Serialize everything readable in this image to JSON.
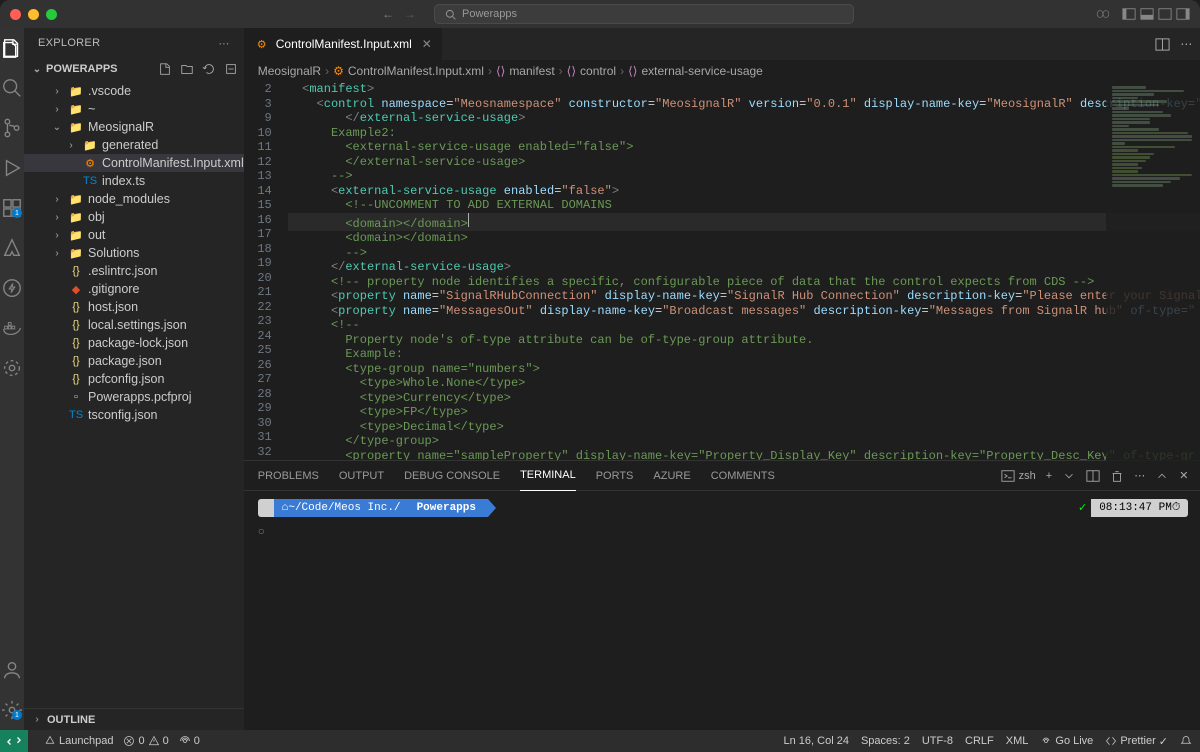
{
  "titlebar": {
    "search": "Powerapps"
  },
  "explorer": {
    "title": "EXPLORER",
    "project": "POWERAPPS",
    "outline": "OUTLINE"
  },
  "tree": [
    {
      "indent": 1,
      "chev": "›",
      "icon": "folder",
      "color": "folder-ico",
      "label": ".vscode"
    },
    {
      "indent": 1,
      "chev": "›",
      "icon": "folder",
      "color": "folder-ico",
      "label": "~"
    },
    {
      "indent": 1,
      "chev": "⌄",
      "icon": "folder",
      "color": "folder-ico git",
      "label": "MeosignalR"
    },
    {
      "indent": 2,
      "chev": "›",
      "icon": "folder",
      "color": "folder-ico git",
      "label": "generated"
    },
    {
      "indent": 2,
      "chev": "",
      "icon": "xml",
      "color": "xml-ico",
      "label": "ControlManifest.Input.xml",
      "selected": true
    },
    {
      "indent": 2,
      "chev": "",
      "icon": "ts",
      "color": "ts-ico",
      "label": "index.ts"
    },
    {
      "indent": 1,
      "chev": "›",
      "icon": "folder",
      "color": "folder-ico git",
      "label": "node_modules"
    },
    {
      "indent": 1,
      "chev": "›",
      "icon": "folder",
      "color": "folder-ico",
      "label": "obj"
    },
    {
      "indent": 1,
      "chev": "›",
      "icon": "folder",
      "color": "folder-ico",
      "label": "out"
    },
    {
      "indent": 1,
      "chev": "›",
      "icon": "folder",
      "color": "folder-ico",
      "label": "Solutions"
    },
    {
      "indent": 1,
      "chev": "",
      "icon": "json",
      "color": "js-ico",
      "label": ".eslintrc.json"
    },
    {
      "indent": 1,
      "chev": "",
      "icon": "git",
      "color": "gitig-ico",
      "label": ".gitignore"
    },
    {
      "indent": 1,
      "chev": "",
      "icon": "json",
      "color": "json-ico",
      "label": "host.json"
    },
    {
      "indent": 1,
      "chev": "",
      "icon": "json",
      "color": "json-ico",
      "label": "local.settings.json"
    },
    {
      "indent": 1,
      "chev": "",
      "icon": "json",
      "color": "json-ico",
      "label": "package-lock.json"
    },
    {
      "indent": 1,
      "chev": "",
      "icon": "json",
      "color": "json-ico",
      "label": "package.json"
    },
    {
      "indent": 1,
      "chev": "",
      "icon": "json",
      "color": "json-ico",
      "label": "pcfconfig.json"
    },
    {
      "indent": 1,
      "chev": "",
      "icon": "file",
      "color": "",
      "label": "Powerapps.pcfproj"
    },
    {
      "indent": 1,
      "chev": "",
      "icon": "ts",
      "color": "ts-ico",
      "label": "tsconfig.json"
    }
  ],
  "tab": {
    "filename": "ControlManifest.Input.xml"
  },
  "breadcrumb": [
    {
      "icon": "folder",
      "label": "MeosignalR"
    },
    {
      "icon": "xml",
      "label": "ControlManifest.Input.xml"
    },
    {
      "icon": "brackets",
      "label": "manifest"
    },
    {
      "icon": "brackets",
      "label": "control"
    },
    {
      "icon": "brackets",
      "label": "external-service-usage"
    }
  ],
  "code": {
    "lines": [
      2,
      3,
      9,
      10,
      11,
      12,
      13,
      14,
      15,
      16,
      17,
      18,
      19,
      20,
      21,
      22,
      23,
      24,
      25,
      26,
      27,
      28,
      29,
      30,
      31,
      32
    ]
  },
  "panel": {
    "tabs": [
      "PROBLEMS",
      "OUTPUT",
      "DEBUG CONSOLE",
      "TERMINAL",
      "PORTS",
      "AZURE",
      "COMMENTS"
    ],
    "active": "TERMINAL",
    "shell": "zsh",
    "prompt_path": "~/Code/Meos Inc./",
    "prompt_bold": "Powerapps",
    "time": "08:13:47 PM"
  },
  "status": {
    "launchpad": "Launchpad",
    "err": "0",
    "warn": "0",
    "port": "0",
    "pos": "Ln 16, Col 24",
    "spaces": "Spaces: 2",
    "enc": "UTF-8",
    "eol": "CRLF",
    "lang": "XML",
    "golive": "Go Live",
    "prettier": "Prettier"
  }
}
